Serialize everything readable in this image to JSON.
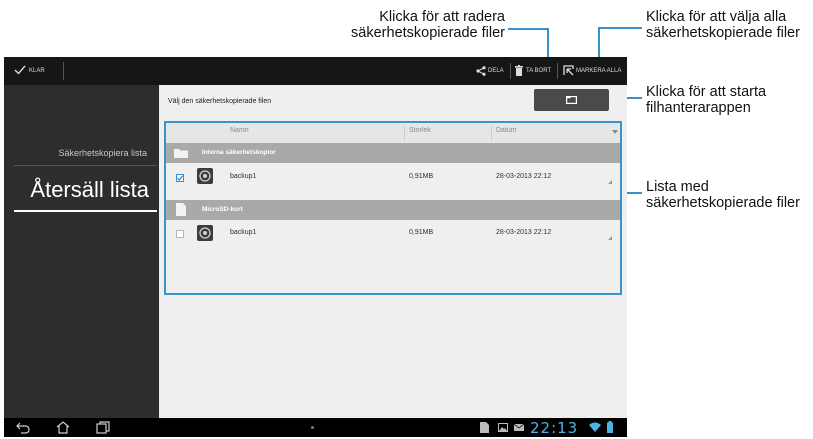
{
  "annotations": {
    "delete": [
      "Klicka för att radera",
      "säkerhetskopierade filer"
    ],
    "select_all": [
      "Klicka för att välja alla",
      "säkerhetskopierade filer"
    ],
    "file_manager": [
      "Klicka för att starta",
      "filhanterarappen"
    ],
    "list": [
      "Lista med",
      "säkerhetskopierade filer"
    ]
  },
  "action_bar": {
    "done_label": "KLAR",
    "share_label": "DELA",
    "delete_label": "TA BORT",
    "select_all_label": "MARKERA ALLA"
  },
  "sidebar": {
    "items": [
      {
        "label": "Säkerhetskopiera lista",
        "active": false
      },
      {
        "label": "Återsäll lista",
        "active": true
      }
    ]
  },
  "content": {
    "title": "Välj den säkerhetskopierade filen",
    "columns": [
      "Namn",
      "Storlek",
      "Datum"
    ],
    "groups": [
      {
        "label": "Interna säkerhetskopior",
        "icon": "folder-icon",
        "rows": [
          {
            "name": "backup1",
            "size": "0,91MB",
            "date": "28-03-2013 22:12",
            "checked": true
          }
        ]
      },
      {
        "label": "MicroSD-kort",
        "icon": "sd-card-icon",
        "rows": [
          {
            "name": "backup1",
            "size": "0,91MB",
            "date": "28-03-2013 22:12",
            "checked": false
          }
        ]
      }
    ]
  },
  "status_bar": {
    "time": "22:13"
  },
  "colors": {
    "accent": "#3a92c8",
    "clock": "#4fb3e6"
  }
}
